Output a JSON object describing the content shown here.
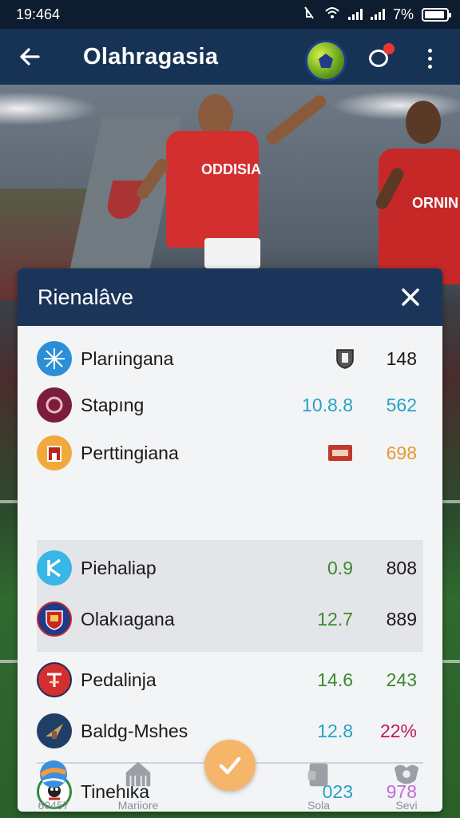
{
  "status_bar": {
    "time": "19:464",
    "battery": "7%"
  },
  "app_bar": {
    "title": "Olahragasia"
  },
  "card": {
    "title": "Rienalâve",
    "rows": [
      {
        "name": "Plarıingana",
        "value1": "",
        "value2": "148",
        "value1_color": "#1a1a1a",
        "value2_color": "#1a1a1a"
      },
      {
        "name": "Stapıng",
        "value1": "10.8.8",
        "value2": "562",
        "value1_color": "#26a3c4",
        "value2_color": "#26a3c4"
      },
      {
        "name": "Perttingiana",
        "value1": "",
        "value2": "698",
        "value1_color": "#1a1a1a",
        "value2_color": "#e39a34"
      },
      {
        "name": "Piehaliap",
        "value1": "0.9",
        "value2": "808",
        "value1_color": "#3c8a2e",
        "value2_color": "#1a1a1a"
      },
      {
        "name": "Olakıagana",
        "value1": "12.7",
        "value2": "889",
        "value1_color": "#3c8a2e",
        "value2_color": "#1a1a1a"
      },
      {
        "name": "Pedalinja",
        "value1": "14.6",
        "value2": "243",
        "value1_color": "#3c8a2e",
        "value2_color": "#3c8a2e"
      },
      {
        "name": "Baldg-Mshes",
        "value1": "12.8",
        "value2": "22%",
        "value1_color": "#26a3c4",
        "value2_color": "#c2185b"
      },
      {
        "name": "Tinehika",
        "value1": "023",
        "value2": "978",
        "value1_color": "#26a3c4",
        "value2_color": "#c46ad8"
      }
    ]
  },
  "bottom_nav": {
    "items": [
      {
        "label": "60457",
        "icon": "globe-icon"
      },
      {
        "label": "Mariiore",
        "icon": "home-icon"
      },
      {
        "label": "Sola",
        "icon": "document-icon"
      },
      {
        "label": "Sevi",
        "icon": "shield-icon"
      }
    ],
    "fab_icon": "check-icon"
  },
  "hero": {
    "sponsor_left": "ODDISIA",
    "sponsor_right": "ORNIN"
  }
}
